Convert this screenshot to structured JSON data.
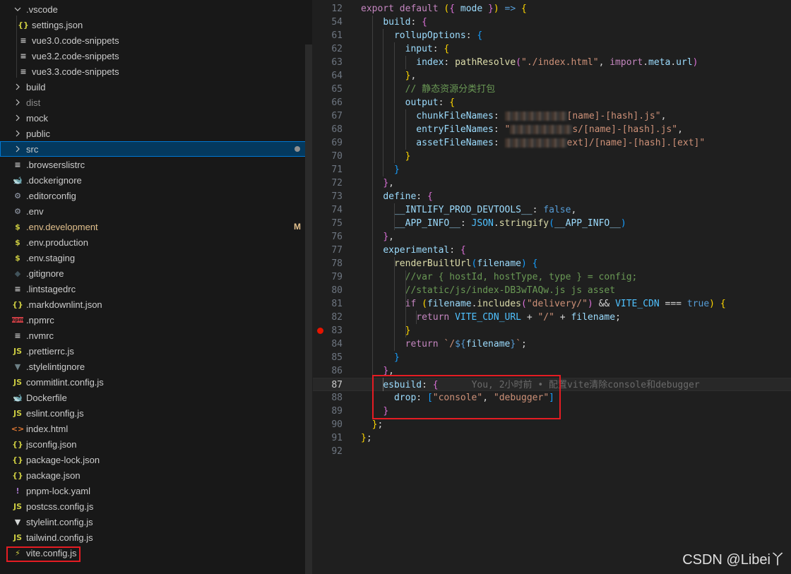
{
  "explorer": {
    "items": [
      {
        "label": ".vscode",
        "type": "folder-open",
        "depth": 0,
        "icon": "chevron-down"
      },
      {
        "label": "settings.json",
        "type": "file",
        "depth": 1,
        "icon": "json-braces",
        "glyph": "{}",
        "color": "#cbcb41"
      },
      {
        "label": "vue3.0.code-snippets",
        "type": "file",
        "depth": 1,
        "icon": "lines",
        "glyph": "≡",
        "color": "#cccccc"
      },
      {
        "label": "vue3.2.code-snippets",
        "type": "file",
        "depth": 1,
        "icon": "lines",
        "glyph": "≡",
        "color": "#cccccc"
      },
      {
        "label": "vue3.3.code-snippets",
        "type": "file",
        "depth": 1,
        "icon": "lines",
        "glyph": "≡",
        "color": "#cccccc"
      },
      {
        "label": "build",
        "type": "folder",
        "depth": 0
      },
      {
        "label": "dist",
        "type": "folder",
        "depth": 0,
        "state": "dim"
      },
      {
        "label": "mock",
        "type": "folder",
        "depth": 0
      },
      {
        "label": "public",
        "type": "folder",
        "depth": 0
      },
      {
        "label": "src",
        "type": "folder",
        "depth": 0,
        "state": "selected",
        "dot": true
      },
      {
        "label": ".browserslistrc",
        "type": "file",
        "depth": 0,
        "icon": "lines",
        "glyph": "≡",
        "color": "#cccccc"
      },
      {
        "label": ".dockerignore",
        "type": "file",
        "depth": 0,
        "icon": "docker",
        "glyph": "🐋",
        "color": "#5a6a7a"
      },
      {
        "label": ".editorconfig",
        "type": "file",
        "depth": 0,
        "icon": "gear",
        "glyph": "⚙",
        "color": "#9da5b4"
      },
      {
        "label": ".env",
        "type": "file",
        "depth": 0,
        "icon": "gear",
        "glyph": "⚙",
        "color": "#9da5b4"
      },
      {
        "label": ".env.development",
        "type": "file",
        "depth": 0,
        "icon": "dollar",
        "glyph": "$",
        "color": "#cbcb41",
        "state": "modified",
        "badge": "M"
      },
      {
        "label": ".env.production",
        "type": "file",
        "depth": 0,
        "icon": "dollar",
        "glyph": "$",
        "color": "#cbcb41"
      },
      {
        "label": ".env.staging",
        "type": "file",
        "depth": 0,
        "icon": "dollar",
        "glyph": "$",
        "color": "#cbcb41"
      },
      {
        "label": ".gitignore",
        "type": "file",
        "depth": 0,
        "icon": "git",
        "glyph": "◆",
        "color": "#41535b"
      },
      {
        "label": ".lintstagedrc",
        "type": "file",
        "depth": 0,
        "icon": "lines",
        "glyph": "≡",
        "color": "#cccccc"
      },
      {
        "label": ".markdownlint.json",
        "type": "file",
        "depth": 0,
        "icon": "json-braces",
        "glyph": "{}",
        "color": "#cbcb41"
      },
      {
        "label": ".npmrc",
        "type": "file",
        "depth": 0,
        "icon": "npm",
        "glyph": "npm",
        "color": "#cc3e44"
      },
      {
        "label": ".nvmrc",
        "type": "file",
        "depth": 0,
        "icon": "lines",
        "glyph": "≡",
        "color": "#cccccc"
      },
      {
        "label": ".prettierrc.js",
        "type": "file",
        "depth": 0,
        "icon": "js",
        "glyph": "JS",
        "color": "#cbcb41"
      },
      {
        "label": ".stylelintignore",
        "type": "file",
        "depth": 0,
        "icon": "stylelint",
        "glyph": "▼",
        "color": "#6d8086"
      },
      {
        "label": "commitlint.config.js",
        "type": "file",
        "depth": 0,
        "icon": "js",
        "glyph": "JS",
        "color": "#cbcb41"
      },
      {
        "label": "Dockerfile",
        "type": "file",
        "depth": 0,
        "icon": "docker",
        "glyph": "🐋",
        "color": "#519aba"
      },
      {
        "label": "eslint.config.js",
        "type": "file",
        "depth": 0,
        "icon": "js",
        "glyph": "JS",
        "color": "#cbcb41"
      },
      {
        "label": "index.html",
        "type": "file",
        "depth": 0,
        "icon": "html",
        "glyph": "<>",
        "color": "#e37933"
      },
      {
        "label": "jsconfig.json",
        "type": "file",
        "depth": 0,
        "icon": "json-braces",
        "glyph": "{}",
        "color": "#cbcb41"
      },
      {
        "label": "package-lock.json",
        "type": "file",
        "depth": 0,
        "icon": "json-braces",
        "glyph": "{}",
        "color": "#cbcb41"
      },
      {
        "label": "package.json",
        "type": "file",
        "depth": 0,
        "icon": "json-braces",
        "glyph": "{}",
        "color": "#cbcb41"
      },
      {
        "label": "pnpm-lock.yaml",
        "type": "file",
        "depth": 0,
        "icon": "yaml",
        "glyph": "!",
        "color": "#a074c4"
      },
      {
        "label": "postcss.config.js",
        "type": "file",
        "depth": 0,
        "icon": "js",
        "glyph": "JS",
        "color": "#cbcb41"
      },
      {
        "label": "stylelint.config.js",
        "type": "file",
        "depth": 0,
        "icon": "stylelint",
        "glyph": "▼",
        "color": "#d4d7d6"
      },
      {
        "label": "tailwind.config.js",
        "type": "file",
        "depth": 0,
        "icon": "js",
        "glyph": "JS",
        "color": "#cbcb41"
      },
      {
        "label": "vite.config.js",
        "type": "file",
        "depth": 0,
        "icon": "vite-bolt",
        "glyph": "⚡",
        "color": "#cbcb41"
      }
    ]
  },
  "editor": {
    "lines": [
      {
        "n": "12",
        "html": "<span class='k'>export</span> <span class='k'>default</span> <span class='b1'>(</span><span class='b2'>{</span> <span class='p'>mode</span> <span class='b2'>}</span><span class='b1'>)</span> <span class='k2'>=&gt;</span> <span class='b1'>{</span>"
      },
      {
        "n": "54",
        "html": "    <span class='p'>build</span><span class='w'>:</span> <span class='b2'>{</span>"
      },
      {
        "n": "61",
        "html": "      <span class='p'>rollupOptions</span><span class='w'>:</span> <span class='b3'>{</span>"
      },
      {
        "n": "62",
        "html": "        <span class='p'>input</span><span class='w'>:</span> <span class='b1'>{</span>"
      },
      {
        "n": "63",
        "html": "          <span class='p'>index</span><span class='w'>:</span> <span class='f'>pathResolve</span><span class='b2'>(</span><span class='s'>\"./index.html\"</span><span class='w'>,</span> <span class='k'>import</span><span class='w'>.</span><span class='p'>meta</span><span class='w'>.</span><span class='p'>url</span><span class='b2'>)</span>"
      },
      {
        "n": "64",
        "html": "        <span class='b1'>}</span><span class='w'>,</span>"
      },
      {
        "n": "65",
        "html": "        <span class='c'>// 静态资源分类打包</span>"
      },
      {
        "n": "66",
        "html": "        <span class='p'>output</span><span class='w'>:</span> <span class='b1'>{</span>"
      },
      {
        "n": "67",
        "html": "          <span class='p'>chunkFileNames</span><span class='w'>:</span> <span class='blur'></span><span class='s'>[name]-[hash].js\"</span><span class='w'>,</span>"
      },
      {
        "n": "68",
        "html": "          <span class='p'>entryFileNames</span><span class='w'>:</span> <span class='s'>\"</span><span class='blur'></span><span class='s'>s/[name]-[hash].js\"</span><span class='w'>,</span>"
      },
      {
        "n": "69",
        "html": "          <span class='p'>assetFileNames</span><span class='w'>:</span> <span class='blur'></span><span class='s'>ext]/[name]-[hash].[ext]\"</span>"
      },
      {
        "n": "70",
        "html": "        <span class='b1'>}</span>"
      },
      {
        "n": "71",
        "html": "      <span class='b3'>}</span>"
      },
      {
        "n": "72",
        "html": "    <span class='b2'>}</span><span class='w'>,</span>"
      },
      {
        "n": "73",
        "html": "    <span class='p'>define</span><span class='w'>:</span> <span class='b2'>{</span>"
      },
      {
        "n": "74",
        "html": "      <span class='p'>__INTLIFY_PROD_DEVTOOLS__</span><span class='w'>:</span> <span class='k2'>false</span><span class='w'>,</span>"
      },
      {
        "n": "75",
        "html": "      <span class='p'>__APP_INFO__</span><span class='w'>:</span> <span class='cst'>JSON</span><span class='w'>.</span><span class='f'>stringify</span><span class='b3'>(</span><span class='p'>__APP_INFO__</span><span class='b3'>)</span>"
      },
      {
        "n": "76",
        "html": "    <span class='b2'>}</span><span class='w'>,</span>"
      },
      {
        "n": "77",
        "html": "    <span class='p'>experimental</span><span class='w'>:</span> <span class='b2'>{</span>"
      },
      {
        "n": "78",
        "html": "      <span class='f'>renderBuiltUrl</span><span class='b3'>(</span><span class='p'>filename</span><span class='b3'>)</span> <span class='b3'>{</span>"
      },
      {
        "n": "79",
        "html": "        <span class='c'>//var { hostId, hostType, type } = config;</span>"
      },
      {
        "n": "80",
        "html": "        <span class='c'>//static/js/index-DB3wTAQw.js js asset</span>"
      },
      {
        "n": "81",
        "html": "        <span class='k'>if</span> <span class='b1'>(</span><span class='p'>filename</span><span class='w'>.</span><span class='f'>includes</span><span class='b2'>(</span><span class='s'>\"delivery/\"</span><span class='b2'>)</span> <span class='w'>&amp;&amp;</span> <span class='cst'>VITE_CDN</span> <span class='w'>===</span> <span class='k2'>true</span><span class='b1'>)</span> <span class='b1'>{</span>"
      },
      {
        "n": "82",
        "html": "          <span class='k'>return</span> <span class='cst'>VITE_CDN_URL</span> <span class='w'>+</span> <span class='s'>\"/\"</span> <span class='w'>+</span> <span class='p'>filename</span><span class='w'>;</span>"
      },
      {
        "n": "83",
        "html": "        <span class='b1'>}</span>",
        "breakpoint": true
      },
      {
        "n": "84",
        "html": "        <span class='k'>return</span> <span class='s'>`/</span><span class='k2'>${</span><span class='p'>filename</span><span class='k2'>}</span><span class='s'>`</span><span class='w'>;</span>"
      },
      {
        "n": "85",
        "html": "      <span class='b3'>}</span>"
      },
      {
        "n": "86",
        "html": "    <span class='b2'>}</span><span class='w'>,</span>"
      },
      {
        "n": "87",
        "html": "    <span class='p'>esbuild</span><span class='w'>:</span> <span class='b2'>{</span>      <span class='blame'>You, 2小时前 • 配置vite清除console和debugger</span>",
        "current": true
      },
      {
        "n": "88",
        "html": "      <span class='p'>drop</span><span class='w'>:</span> <span class='b3'>[</span><span class='s'>\"console\"</span><span class='w'>,</span> <span class='s'>\"debugger\"</span><span class='b3'>]</span>"
      },
      {
        "n": "89",
        "html": "    <span class='b2'>}</span>"
      },
      {
        "n": "90",
        "html": "  <span class='b1'>}</span><span class='w'>;</span>"
      },
      {
        "n": "91",
        "html": "<span class='b1'>}</span><span class='w'>;</span>"
      },
      {
        "n": "92",
        "html": ""
      }
    ]
  },
  "watermark": "CSDN @Libei丫"
}
